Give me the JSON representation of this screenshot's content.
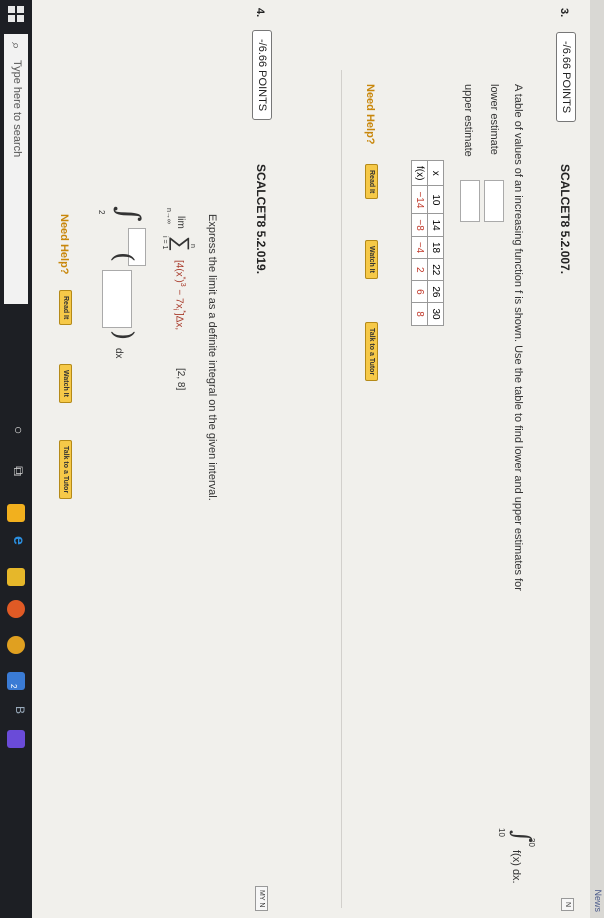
{
  "header": {
    "news_label": "News"
  },
  "problem3": {
    "number": "3.",
    "points": "-/6.66 POINTS",
    "code": "SCALCET8 5.2.007.",
    "prompt": "A table of values of an increasing function f is shown. Use the table to find lower and upper estimates for",
    "integral": {
      "upper": "30",
      "lower": "10",
      "integrand": "f(x) dx."
    },
    "lower_label": "lower estimate",
    "upper_label": "upper estimate",
    "table": {
      "x_label": "x",
      "fx_label": "f(x)",
      "x": [
        "10",
        "14",
        "18",
        "22",
        "26",
        "30"
      ],
      "fx": [
        "−14",
        "−8",
        "−4",
        "2",
        "6",
        "8"
      ]
    },
    "need_help": "Need Help?",
    "buttons": [
      "Read It",
      "Watch It",
      "Talk to a Tutor"
    ],
    "side_button": "N"
  },
  "problem4": {
    "number": "4.",
    "points": "-/6.66 POINTS",
    "code": "SCALCET8 5.2.019.",
    "my_notes": "MY N",
    "prompt": "Express the limit as a definite integral on the given interval.",
    "lim": "lim",
    "lim_sub": "n→∞",
    "sigma_top": "n",
    "sigma_bottom": "i = 1",
    "expr": "[4(x",
    "expr_sup": "3",
    "expr_rest": " − 7x",
    "expr_end": "]Δx,",
    "interval": "[2, 8]",
    "int_lower": "2",
    "dx": "dx",
    "need_help": "Need Help?",
    "buttons": [
      "Read It",
      "Watch It",
      "Talk to a Tutor"
    ]
  },
  "taskbar": {
    "search_placeholder": "Type here to search",
    "badge_count": "2",
    "badge_letter": "B"
  },
  "colors": {
    "need_help": "#c8860a",
    "help_button": "#f6c948",
    "taskbar": "#1d1f24"
  }
}
